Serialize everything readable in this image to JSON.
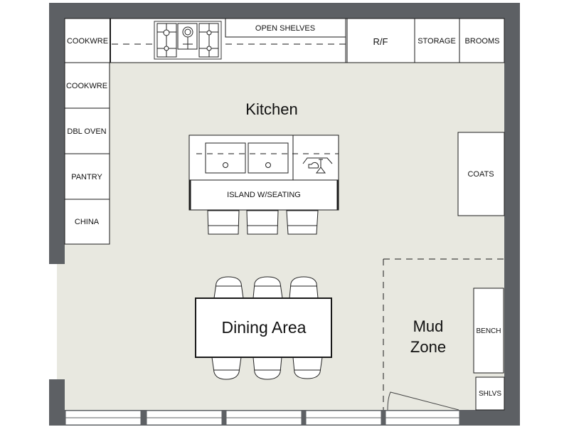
{
  "plan": {
    "colors": {
      "wall": "#5d6064",
      "floor": "#e8e8e0",
      "fixture": "#ffffff",
      "line": "#1a1a1a"
    },
    "rooms": {
      "kitchen": "Kitchen",
      "dining": "Dining Area",
      "mud_line1": "Mud",
      "mud_line2": "Zone"
    },
    "top_cabinets": {
      "cookware": "COOKWRE",
      "open_shelves": "OPEN SHELVES",
      "fridge": "R/F",
      "storage": "STORAGE",
      "brooms": "BROOMS"
    },
    "left_cabinets": [
      "COOKWRE",
      "DBL OVEN",
      "PANTRY",
      "CHINA"
    ],
    "island": {
      "label": "ISLAND W/SEATING",
      "stool_count": 3
    },
    "dining_table": {
      "chairs_per_side": 3
    },
    "right_fixtures": {
      "coats": "COATS",
      "bench": "BENCH",
      "shelves": "SHLVS"
    },
    "icons": {
      "cooktop": "cooktop-icon",
      "sink": "double-sink-icon",
      "faucet": "faucet-dishwasher-icon",
      "door": "door-swing-icon",
      "window": "window-icon"
    }
  }
}
